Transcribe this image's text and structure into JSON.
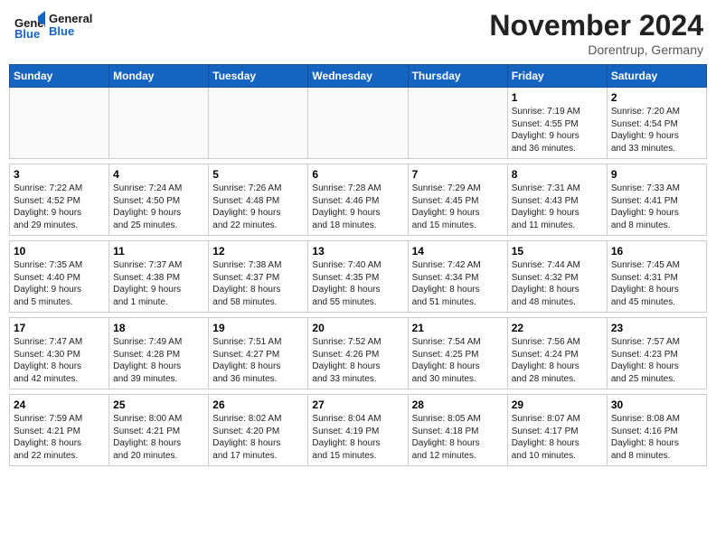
{
  "header": {
    "logo_general": "General",
    "logo_blue": "Blue",
    "month_title": "November 2024",
    "subtitle": "Dorentrup, Germany"
  },
  "weekdays": [
    "Sunday",
    "Monday",
    "Tuesday",
    "Wednesday",
    "Thursday",
    "Friday",
    "Saturday"
  ],
  "weeks": [
    [
      {
        "day": "",
        "info": ""
      },
      {
        "day": "",
        "info": ""
      },
      {
        "day": "",
        "info": ""
      },
      {
        "day": "",
        "info": ""
      },
      {
        "day": "",
        "info": ""
      },
      {
        "day": "1",
        "info": "Sunrise: 7:19 AM\nSunset: 4:55 PM\nDaylight: 9 hours\nand 36 minutes."
      },
      {
        "day": "2",
        "info": "Sunrise: 7:20 AM\nSunset: 4:54 PM\nDaylight: 9 hours\nand 33 minutes."
      }
    ],
    [
      {
        "day": "3",
        "info": "Sunrise: 7:22 AM\nSunset: 4:52 PM\nDaylight: 9 hours\nand 29 minutes."
      },
      {
        "day": "4",
        "info": "Sunrise: 7:24 AM\nSunset: 4:50 PM\nDaylight: 9 hours\nand 25 minutes."
      },
      {
        "day": "5",
        "info": "Sunrise: 7:26 AM\nSunset: 4:48 PM\nDaylight: 9 hours\nand 22 minutes."
      },
      {
        "day": "6",
        "info": "Sunrise: 7:28 AM\nSunset: 4:46 PM\nDaylight: 9 hours\nand 18 minutes."
      },
      {
        "day": "7",
        "info": "Sunrise: 7:29 AM\nSunset: 4:45 PM\nDaylight: 9 hours\nand 15 minutes."
      },
      {
        "day": "8",
        "info": "Sunrise: 7:31 AM\nSunset: 4:43 PM\nDaylight: 9 hours\nand 11 minutes."
      },
      {
        "day": "9",
        "info": "Sunrise: 7:33 AM\nSunset: 4:41 PM\nDaylight: 9 hours\nand 8 minutes."
      }
    ],
    [
      {
        "day": "10",
        "info": "Sunrise: 7:35 AM\nSunset: 4:40 PM\nDaylight: 9 hours\nand 5 minutes."
      },
      {
        "day": "11",
        "info": "Sunrise: 7:37 AM\nSunset: 4:38 PM\nDaylight: 9 hours\nand 1 minute."
      },
      {
        "day": "12",
        "info": "Sunrise: 7:38 AM\nSunset: 4:37 PM\nDaylight: 8 hours\nand 58 minutes."
      },
      {
        "day": "13",
        "info": "Sunrise: 7:40 AM\nSunset: 4:35 PM\nDaylight: 8 hours\nand 55 minutes."
      },
      {
        "day": "14",
        "info": "Sunrise: 7:42 AM\nSunset: 4:34 PM\nDaylight: 8 hours\nand 51 minutes."
      },
      {
        "day": "15",
        "info": "Sunrise: 7:44 AM\nSunset: 4:32 PM\nDaylight: 8 hours\nand 48 minutes."
      },
      {
        "day": "16",
        "info": "Sunrise: 7:45 AM\nSunset: 4:31 PM\nDaylight: 8 hours\nand 45 minutes."
      }
    ],
    [
      {
        "day": "17",
        "info": "Sunrise: 7:47 AM\nSunset: 4:30 PM\nDaylight: 8 hours\nand 42 minutes."
      },
      {
        "day": "18",
        "info": "Sunrise: 7:49 AM\nSunset: 4:28 PM\nDaylight: 8 hours\nand 39 minutes."
      },
      {
        "day": "19",
        "info": "Sunrise: 7:51 AM\nSunset: 4:27 PM\nDaylight: 8 hours\nand 36 minutes."
      },
      {
        "day": "20",
        "info": "Sunrise: 7:52 AM\nSunset: 4:26 PM\nDaylight: 8 hours\nand 33 minutes."
      },
      {
        "day": "21",
        "info": "Sunrise: 7:54 AM\nSunset: 4:25 PM\nDaylight: 8 hours\nand 30 minutes."
      },
      {
        "day": "22",
        "info": "Sunrise: 7:56 AM\nSunset: 4:24 PM\nDaylight: 8 hours\nand 28 minutes."
      },
      {
        "day": "23",
        "info": "Sunrise: 7:57 AM\nSunset: 4:23 PM\nDaylight: 8 hours\nand 25 minutes."
      }
    ],
    [
      {
        "day": "24",
        "info": "Sunrise: 7:59 AM\nSunset: 4:21 PM\nDaylight: 8 hours\nand 22 minutes."
      },
      {
        "day": "25",
        "info": "Sunrise: 8:00 AM\nSunset: 4:21 PM\nDaylight: 8 hours\nand 20 minutes."
      },
      {
        "day": "26",
        "info": "Sunrise: 8:02 AM\nSunset: 4:20 PM\nDaylight: 8 hours\nand 17 minutes."
      },
      {
        "day": "27",
        "info": "Sunrise: 8:04 AM\nSunset: 4:19 PM\nDaylight: 8 hours\nand 15 minutes."
      },
      {
        "day": "28",
        "info": "Sunrise: 8:05 AM\nSunset: 4:18 PM\nDaylight: 8 hours\nand 12 minutes."
      },
      {
        "day": "29",
        "info": "Sunrise: 8:07 AM\nSunset: 4:17 PM\nDaylight: 8 hours\nand 10 minutes."
      },
      {
        "day": "30",
        "info": "Sunrise: 8:08 AM\nSunset: 4:16 PM\nDaylight: 8 hours\nand 8 minutes."
      }
    ]
  ]
}
